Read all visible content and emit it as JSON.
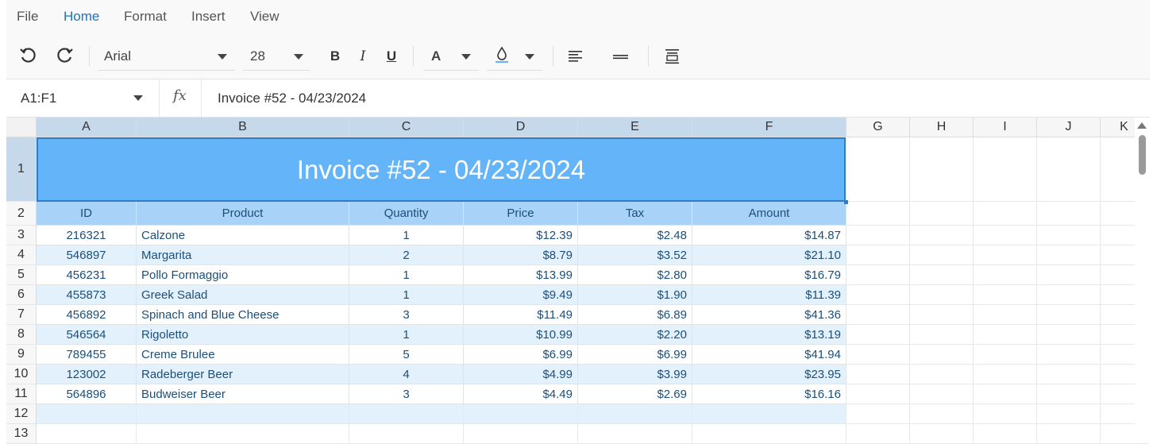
{
  "menu": {
    "file": "File",
    "home": "Home",
    "format": "Format",
    "insert": "Insert",
    "view": "View",
    "active": "Home"
  },
  "toolbar": {
    "font_name": "Arial",
    "font_size": "28",
    "bold": "B",
    "italic": "I",
    "underline": "U",
    "font_color_glyph": "A",
    "icons": [
      "undo-icon",
      "redo-icon",
      "font-color-icon",
      "fill-color-icon",
      "align-left-icon",
      "align-middle-icon",
      "wrap-text-icon"
    ]
  },
  "formula_bar": {
    "cell_ref": "A1:F1",
    "fx_label": "fx",
    "value": "Invoice #52 - 04/23/2024"
  },
  "sheet": {
    "columns": [
      "A",
      "B",
      "C",
      "D",
      "E",
      "F",
      "G",
      "H",
      "I",
      "J",
      "K"
    ],
    "rows": [
      "1",
      "2",
      "3",
      "4",
      "5",
      "6",
      "7",
      "8",
      "9",
      "10",
      "11",
      "12",
      "13"
    ],
    "title": "Invoice #52 - 04/23/2024",
    "headers": [
      "ID",
      "Product",
      "Quantity",
      "Price",
      "Tax",
      "Amount"
    ],
    "data": [
      [
        "216321",
        "Calzone",
        "1",
        "$12.39",
        "$2.48",
        "$14.87"
      ],
      [
        "546897",
        "Margarita",
        "2",
        "$8.79",
        "$3.52",
        "$21.10"
      ],
      [
        "456231",
        "Pollo Formaggio",
        "1",
        "$13.99",
        "$2.80",
        "$16.79"
      ],
      [
        "455873",
        "Greek Salad",
        "1",
        "$9.49",
        "$1.90",
        "$11.39"
      ],
      [
        "456892",
        "Spinach and Blue Cheese",
        "3",
        "$11.49",
        "$6.89",
        "$41.36"
      ],
      [
        "546564",
        "Rigoletto",
        "1",
        "$10.99",
        "$2.20",
        "$13.19"
      ],
      [
        "789455",
        "Creme Brulee",
        "5",
        "$6.99",
        "$6.99",
        "$41.94"
      ],
      [
        "123002",
        "Radeberger Beer",
        "4",
        "$4.99",
        "$3.99",
        "$23.95"
      ],
      [
        "564896",
        "Budweiser Beer",
        "3",
        "$4.49",
        "$2.69",
        "$16.16"
      ]
    ]
  },
  "colors": {
    "accent": "#1e73be",
    "title_fill": "#64b4fa",
    "header_fill": "#a8d2f7",
    "band_fill": "#e3f1fd",
    "cell_text": "#1b4f7a"
  }
}
